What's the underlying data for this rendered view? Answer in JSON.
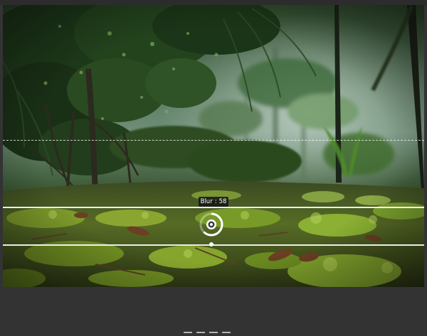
{
  "editor": {
    "tool": "tilt-shift-blur",
    "blur_label": "Blur",
    "blur_separator": ":",
    "blur_value": "58"
  },
  "icons": {
    "blur_control": "blur-pin-icon",
    "panel_grip": "drag-handle-icon"
  },
  "colors": {
    "app_background": "#333334",
    "guide_lines": "#ffffff",
    "tooltip_background": "#141414"
  }
}
